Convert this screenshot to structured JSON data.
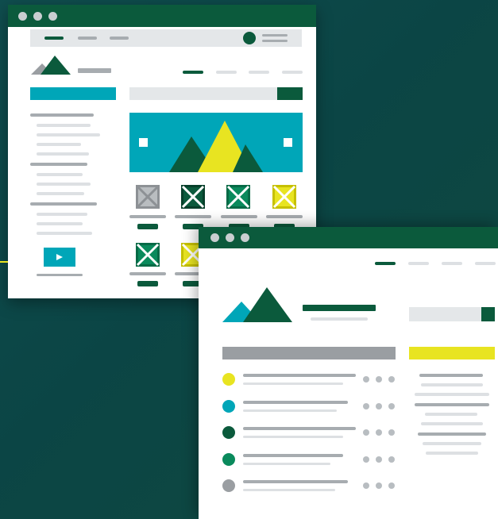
{
  "colors": {
    "background": "#0f4d4e",
    "window_bg": "#ffffff",
    "titlebar": "#0b5a3c",
    "accent_teal": "#00a6b8",
    "accent_yellow": "#e8e421",
    "accent_green": "#0a8a5c",
    "dark_green": "#0b5a3c",
    "gray": "#9a9ea2",
    "light_gray": "#dde0e3"
  },
  "icons": {
    "window_controls": "three-dot-window-controls",
    "logo": "mountain-logo-icon",
    "hero": "mountain-hero-image",
    "thumbnail": "image-placeholder-icon",
    "video": "play-icon",
    "list_bullet": "circle-bullet-icon",
    "more": "more-dots-icon"
  },
  "thumbnail_colors": [
    "#9a9ea2",
    "#0b5a3c",
    "#0a8a5c",
    "#e8e421",
    "#0a8a5c",
    "#e8e421"
  ],
  "list_bullet_colors": [
    "#e8e421",
    "#00a6b8",
    "#0b5a3c",
    "#0a8a5c",
    "#9a9ea2"
  ]
}
